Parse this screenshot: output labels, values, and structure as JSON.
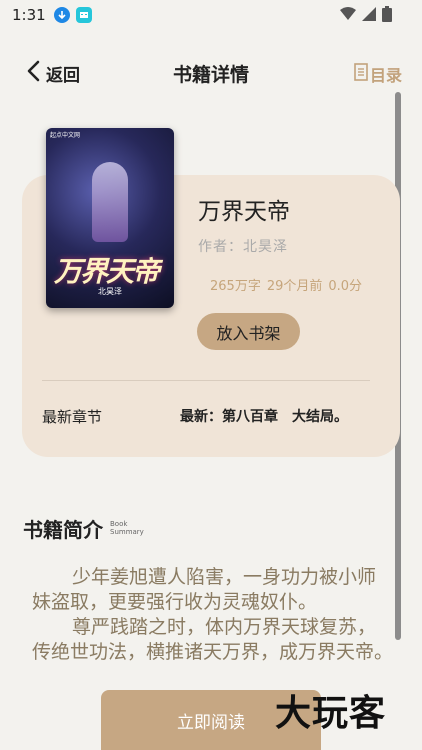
{
  "status_bar": {
    "time": "1:31"
  },
  "header": {
    "back_label": "返回",
    "title": "书籍详情",
    "toc_label": "目录"
  },
  "book": {
    "cover_title": "万界天帝",
    "cover_author": "北昊泽",
    "cover_badge": "起点中文网",
    "name": "万界天帝",
    "author": "作者：北昊泽",
    "word_count": "265万字",
    "updated": "29个月前",
    "score": "0.0分",
    "shelf_button": "放入书架",
    "latest_label": "最新章节",
    "latest_value": "最新：第八百章　大结局。"
  },
  "intro": {
    "title": "书籍简介",
    "subtitle": "Book Summary",
    "paragraph1": "少年姜旭遭人陷害，一身功力被小师妹盗取，更要强行收为灵魂奴仆。",
    "paragraph2": "尊严践踏之时，体内万界天球复苏，传绝世功法，横推诸天万界，成万界天帝。"
  },
  "actions": {
    "read_button": "立即阅读"
  },
  "watermark": "大玩客",
  "colors": {
    "accent": "#c6a783",
    "card_bg": "#f0e4d7",
    "page_bg": "#f3f2ee",
    "stat_text": "#c6a57b",
    "intro_text": "#8a7b62"
  }
}
